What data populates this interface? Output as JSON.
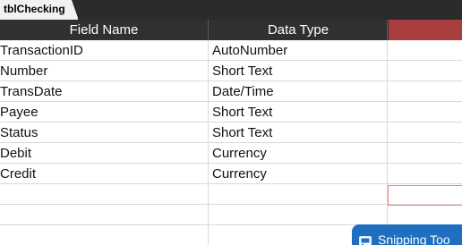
{
  "tab": {
    "label": "tblChecking"
  },
  "columns": {
    "field_name": "Field Name",
    "data_type": "Data Type",
    "description": ""
  },
  "rows": [
    {
      "field": "TransactionID",
      "type": "AutoNumber"
    },
    {
      "field": "Number",
      "type": "Short Text"
    },
    {
      "field": "TransDate",
      "type": "Date/Time"
    },
    {
      "field": "Payee",
      "type": "Short Text"
    },
    {
      "field": "Status",
      "type": "Short Text"
    },
    {
      "field": "Debit",
      "type": "Currency"
    },
    {
      "field": "Credit",
      "type": "Currency"
    },
    {
      "field": "",
      "type": ""
    },
    {
      "field": "",
      "type": ""
    },
    {
      "field": "",
      "type": ""
    }
  ],
  "taskbar_popup": {
    "label": "Snipping Too",
    "icon": "snipping-tool-icon"
  },
  "colors": {
    "header_bg": "#303030",
    "description_header": "#a93e3e",
    "popup_bg": "#1e6fbf"
  }
}
